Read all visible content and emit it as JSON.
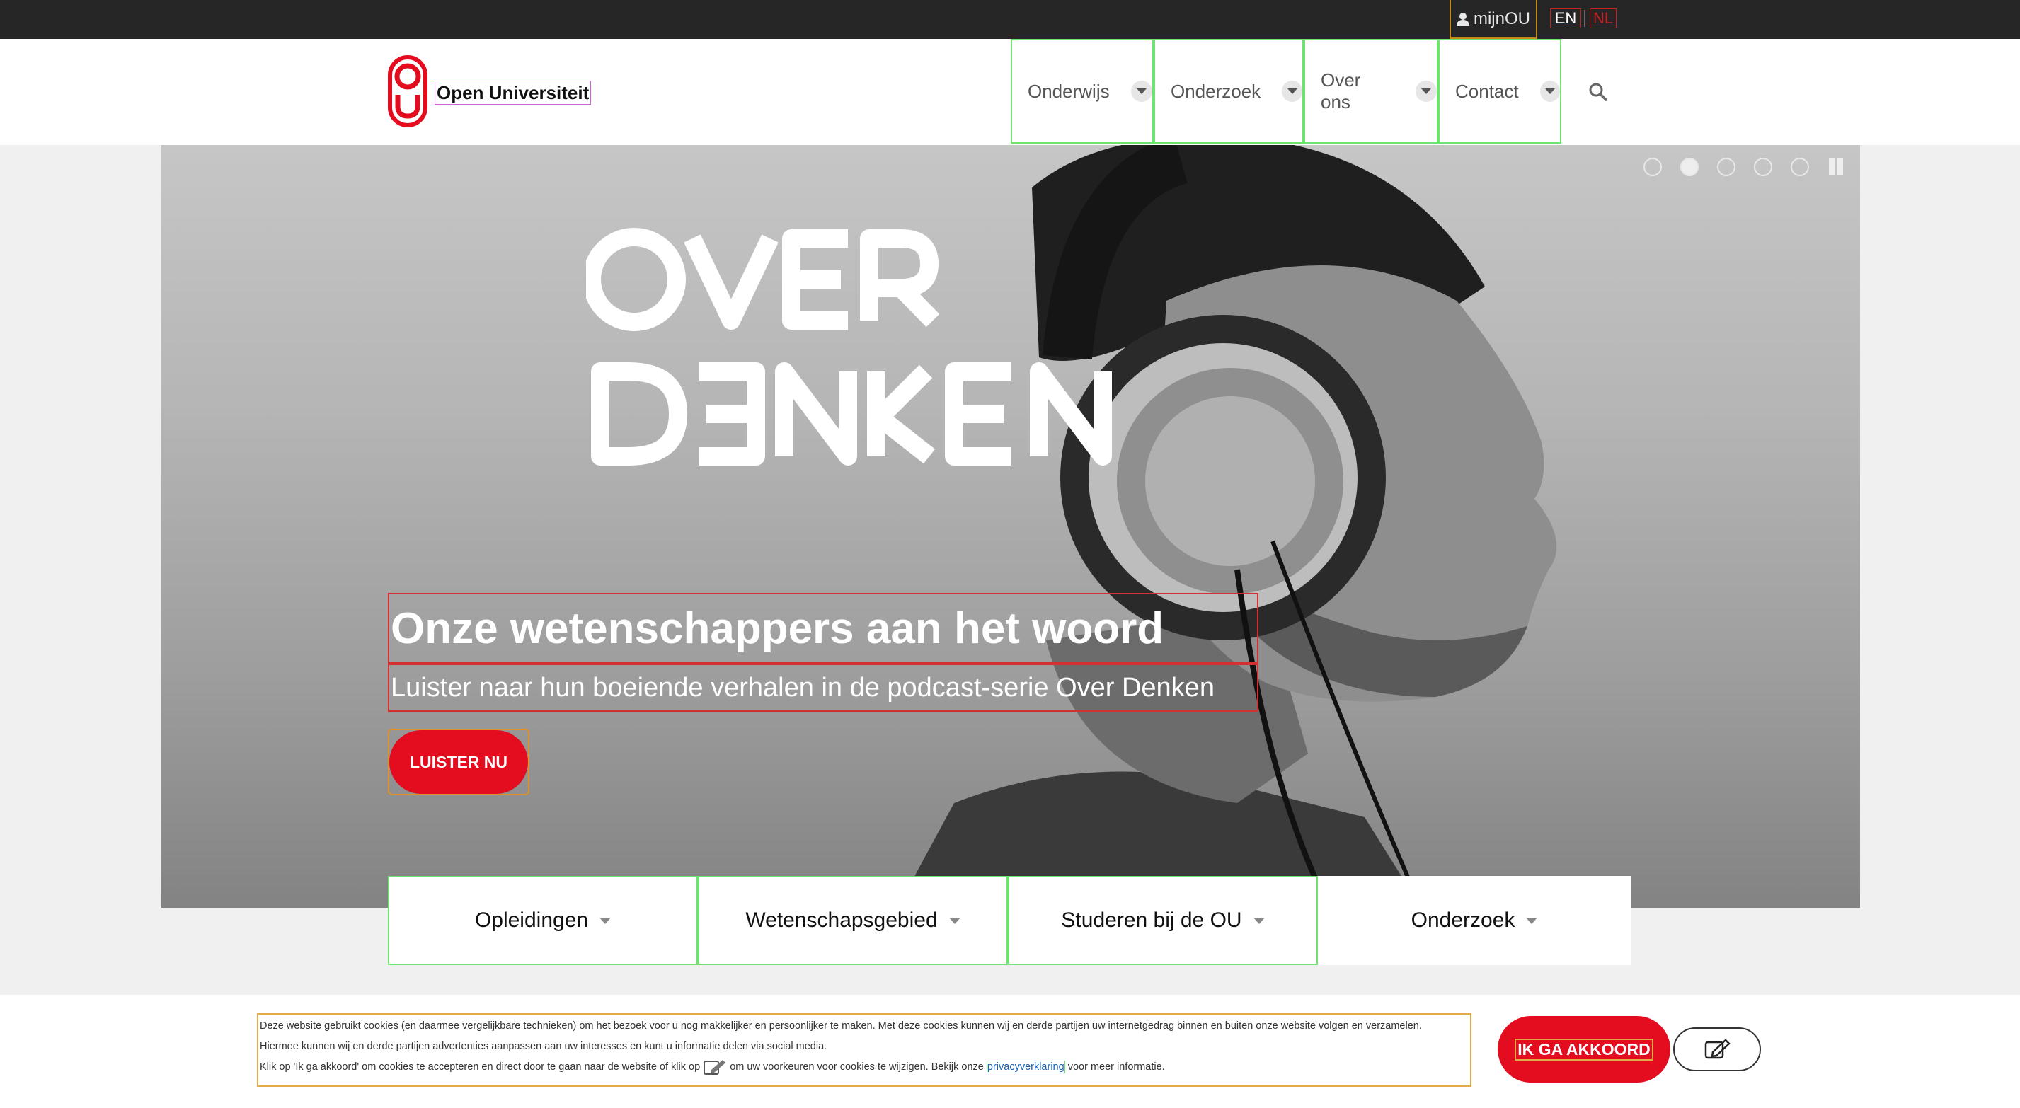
{
  "topbar": {
    "account_label": "mijnOU",
    "languages": [
      "EN",
      "NL"
    ]
  },
  "header": {
    "logo_text": "Open Universiteit",
    "nav": [
      "Onderwijs",
      "Onderzoek",
      "Over ons",
      "Contact"
    ]
  },
  "hero": {
    "title": "Onze wetenschappers aan het woord",
    "subtitle": "Luister naar hun boeiende verhalen in de podcast-serie Over Denken",
    "button": "LUISTER NU",
    "slides_total": 5,
    "active_slide": 2
  },
  "tiles": [
    "Opleidingen",
    "Wetenschapsgebied",
    "Studeren bij de OU",
    "Onderzoek"
  ],
  "cookie": {
    "line1": "Deze website gebruikt cookies (en daarmee vergelijkbare technieken) om het bezoek voor u nog makkelijker en persoonlijker te maken. Met deze cookies kunnen wij en derde partijen uw internetgedrag binnen en buiten onze website volgen en verzamelen.",
    "line2": "Hiermee kunnen wij en derde partijen advertenties aanpassen aan uw interesses en kunt u informatie delen via social media.",
    "line3a": "Klik op 'Ik ga akkoord' om cookies te accepteren en direct door te gaan naar de website of klik op",
    "line3b": "om uw voorkeuren voor cookies te wijzigen. Bekijk onze",
    "privacy_link": "privacyverklaring",
    "line3c": "voor meer informatie.",
    "accept_button": "IK GA AKKOORD"
  },
  "colors": {
    "brand_red": "#e30d1f",
    "topbar": "#262626"
  }
}
